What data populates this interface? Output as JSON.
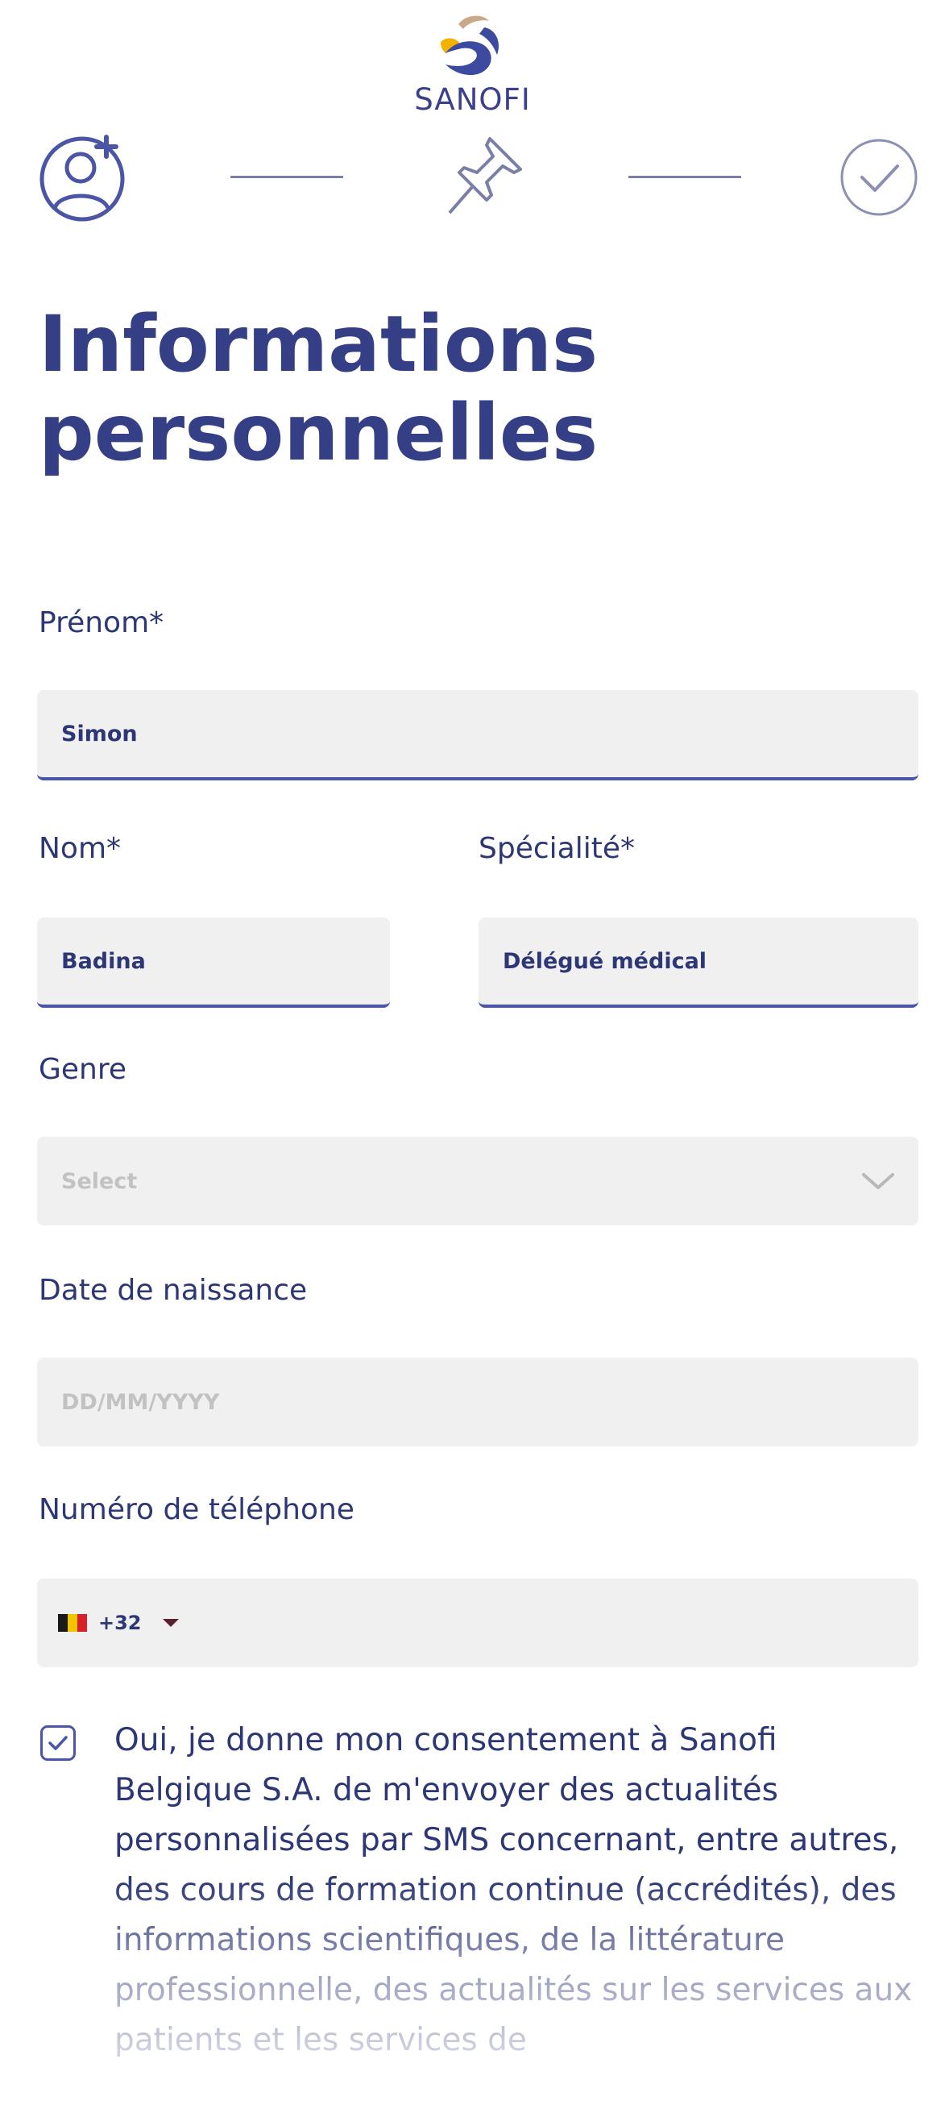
{
  "brand": {
    "logo_text": "SANOFI",
    "colors": {
      "primary": "#353f86",
      "accent_underline": "#4b55a6",
      "logo_yellow": "#f2b300",
      "logo_blue": "#3c4aa0",
      "logo_tan": "#c9a989",
      "field_bg": "#f0f0f0"
    }
  },
  "stepper": {
    "steps": [
      {
        "icon": "user-add-icon",
        "state": "active"
      },
      {
        "icon": "pin-icon",
        "state": "pending"
      },
      {
        "icon": "check-circle-icon",
        "state": "pending"
      }
    ]
  },
  "page": {
    "title_line1": "Informations",
    "title_line2": "personnelles"
  },
  "form": {
    "first_name": {
      "label": "Prénom*",
      "value": "Simon"
    },
    "last_name": {
      "label": "Nom*",
      "value": "Badina"
    },
    "specialty": {
      "label": "Spécialité*",
      "value": "Délégué médical"
    },
    "gender": {
      "label": "Genre",
      "placeholder": "Select"
    },
    "birth_date": {
      "label": "Date de naissance",
      "placeholder": "DD/MM/YYYY"
    },
    "phone": {
      "label": "Numéro de téléphone",
      "dial_code": "+32",
      "country_flag": "Belgium"
    }
  },
  "consent": {
    "checked": true,
    "text": "Oui, je donne mon consentement à Sanofi Belgique S.A. de m'envoyer des actualités personnalisées par SMS concernant, entre autres, des cours de formation continue (accrédités), des informations scientifiques, de la littérature professionnelle, des actualités sur les services aux patients et les services de"
  }
}
